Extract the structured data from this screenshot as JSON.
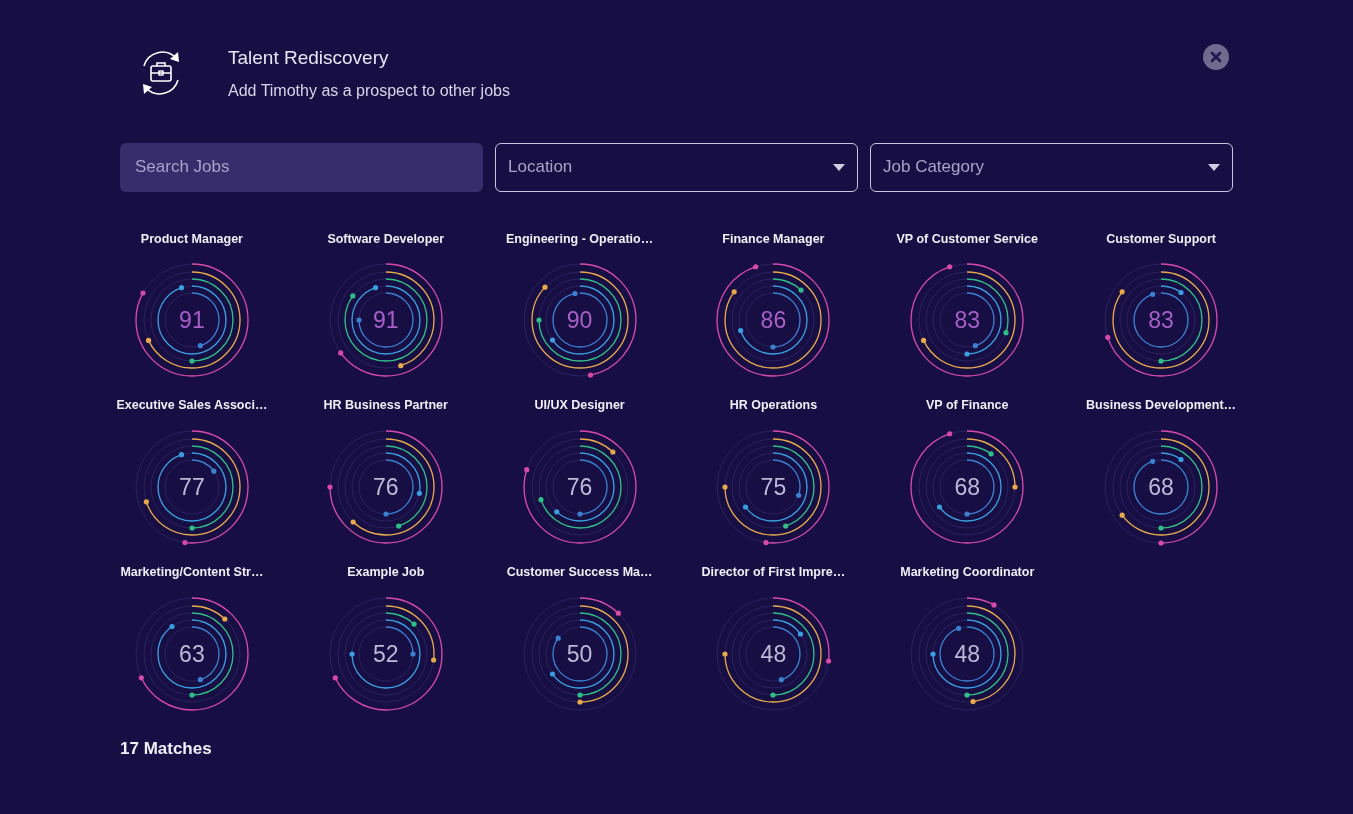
{
  "header": {
    "title": "Talent Rediscovery",
    "subtitle": "Add Timothy as a prospect to other jobs"
  },
  "filters": {
    "search": {
      "placeholder": "Search Jobs"
    },
    "location": {
      "placeholder": "Location"
    },
    "category": {
      "placeholder": "Job Category"
    }
  },
  "jobs": [
    {
      "title": "Product Manager",
      "score": "91",
      "highlighted": true
    },
    {
      "title": "Software Developer",
      "score": "91",
      "highlighted": true
    },
    {
      "title": "Engineering - Operatio…",
      "score": "90",
      "highlighted": true
    },
    {
      "title": "Finance Manager",
      "score": "86",
      "highlighted": true
    },
    {
      "title": "VP of Customer Service",
      "score": "83",
      "highlighted": true
    },
    {
      "title": "Customer Support",
      "score": "83",
      "highlighted": true
    },
    {
      "title": "Executive Sales Associ…",
      "score": "77",
      "highlighted": false
    },
    {
      "title": "HR Business Partner",
      "score": "76",
      "highlighted": false
    },
    {
      "title": "UI/UX Designer",
      "score": "76",
      "highlighted": false
    },
    {
      "title": "HR Operations",
      "score": "75",
      "highlighted": false
    },
    {
      "title": "VP of Finance",
      "score": "68",
      "highlighted": false
    },
    {
      "title": "Business Development…",
      "score": "68",
      "highlighted": false
    },
    {
      "title": "Marketing/Content Str…",
      "score": "63",
      "highlighted": false
    },
    {
      "title": "Example Job",
      "score": "52",
      "highlighted": false
    },
    {
      "title": "Customer Success Ma…",
      "score": "50",
      "highlighted": false
    },
    {
      "title": "Director of First Impre…",
      "score": "48",
      "highlighted": false
    },
    {
      "title": "Marketing Coordinator",
      "score": "48",
      "highlighted": false
    }
  ],
  "matches": "17 Matches"
}
